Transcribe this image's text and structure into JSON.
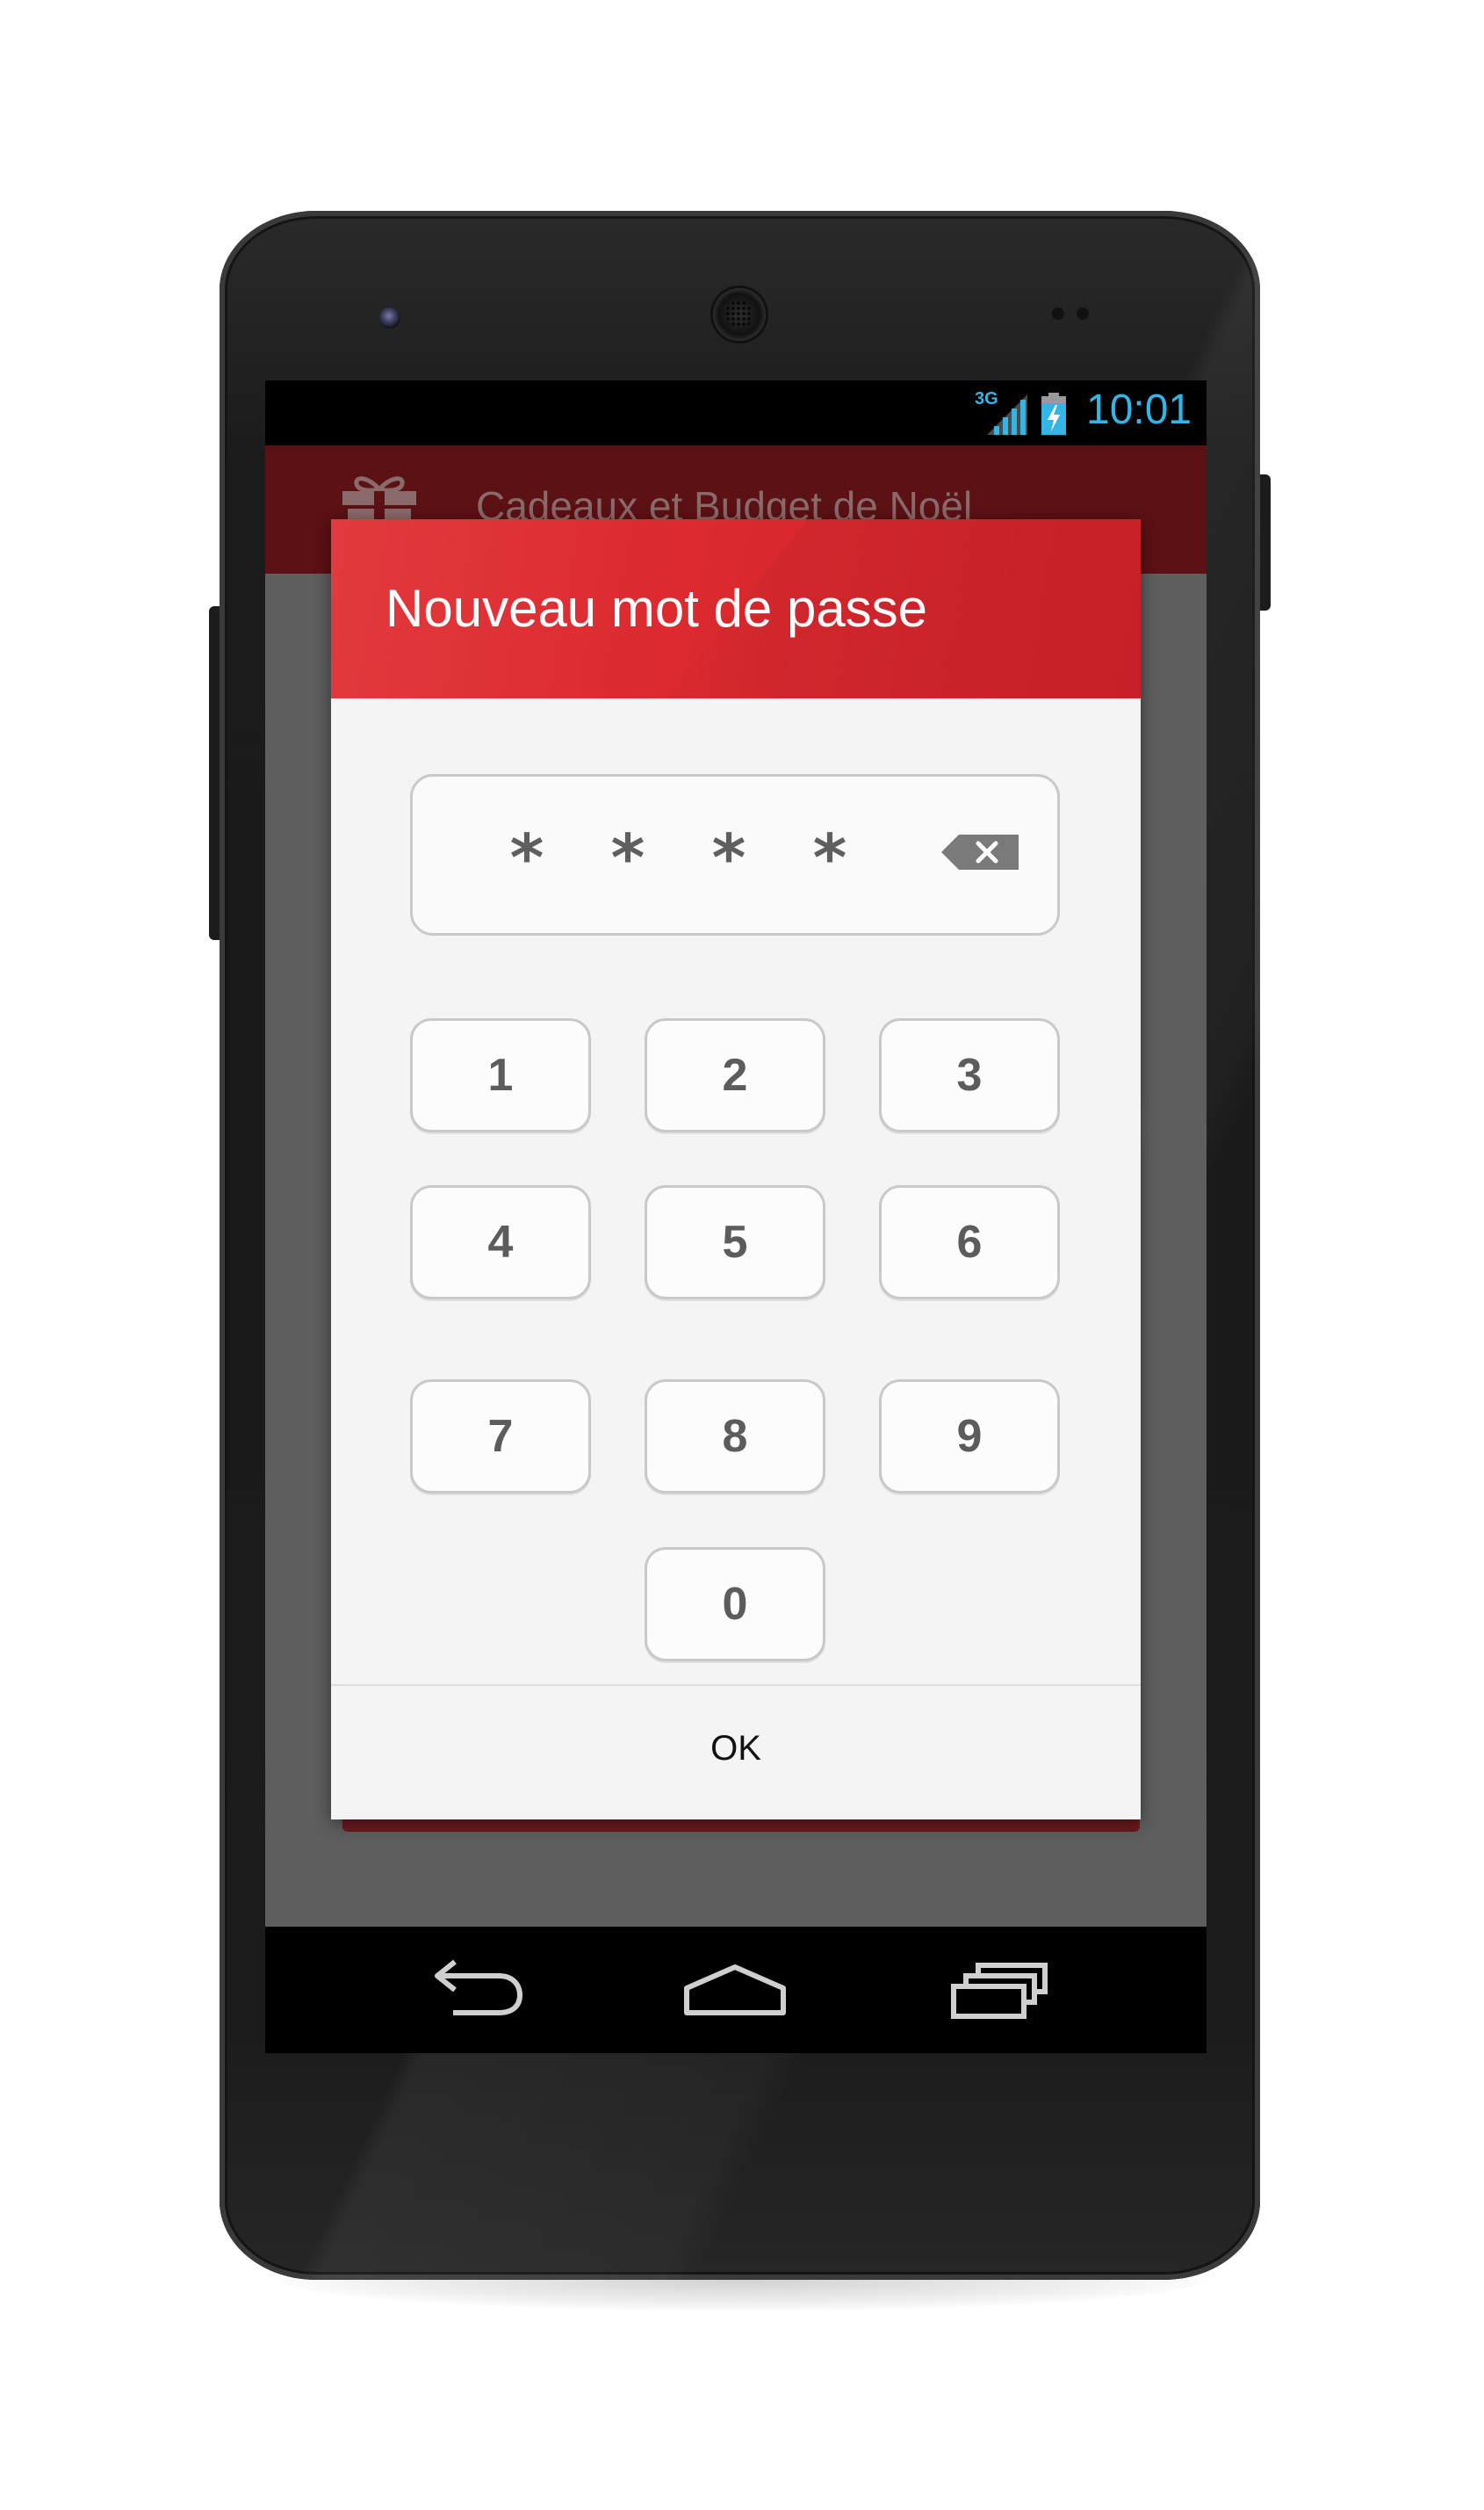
{
  "status_bar": {
    "network_label": "3G",
    "time": "10:01",
    "accent_color": "#33b5e5"
  },
  "app": {
    "title": "Cadeaux et Budget de Noël",
    "icon": "gift-icon",
    "action_bar_color": "#5c1114"
  },
  "dialog": {
    "title": "Nouveau mot de passe",
    "header_color": "#d9272d",
    "pin_mask": [
      "*",
      "*",
      "*",
      "*"
    ],
    "backspace_icon": "backspace-icon",
    "keypad": {
      "k1": "1",
      "k2": "2",
      "k3": "3",
      "k4": "4",
      "k5": "5",
      "k6": "6",
      "k7": "7",
      "k8": "8",
      "k9": "9",
      "k0": "0"
    },
    "ok_label": "OK"
  },
  "nav_bar": {
    "back_icon": "back-icon",
    "home_icon": "home-icon",
    "recents_icon": "recent-apps-icon"
  }
}
